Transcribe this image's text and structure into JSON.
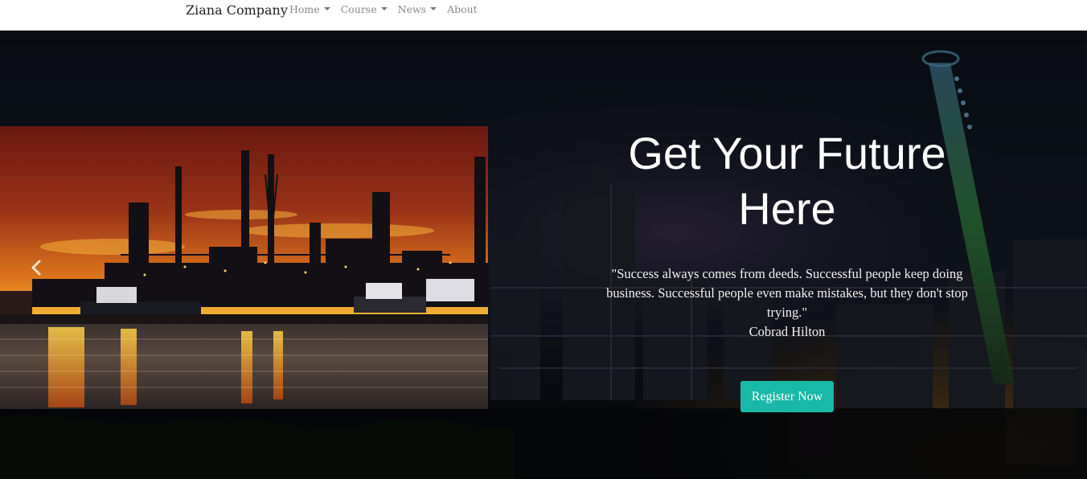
{
  "navbar": {
    "brand": "Ziana Company",
    "items": [
      {
        "label": "Home",
        "dropdown": true
      },
      {
        "label": "Course",
        "dropdown": true
      },
      {
        "label": "News",
        "dropdown": true
      },
      {
        "label": "About",
        "dropdown": false
      }
    ]
  },
  "hero": {
    "title": "Get Your Future Here",
    "quote": "\"Success always comes from deeds. Successful people keep doing business. Successful people even make mistakes, but they don't stop trying.\"",
    "author": "Cobrad Hilton",
    "button_label": "Register Now",
    "button_color": "#1ab8a6"
  },
  "carousel": {
    "prev_icon": "chevron-left-icon"
  }
}
